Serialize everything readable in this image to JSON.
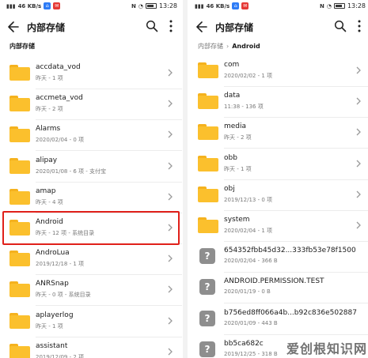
{
  "status": {
    "signal": "46 KB/s",
    "time": "13:28",
    "battery_icon": "battery-icon",
    "left_badge": "8",
    "right_badge": "N"
  },
  "left": {
    "title": "内部存储",
    "breadcrumb": [
      "内部存储"
    ],
    "items": [
      {
        "name": "accdata_vod",
        "meta": "昨天 - 1 项",
        "icon": "folder"
      },
      {
        "name": "accmeta_vod",
        "meta": "昨天 - 2 项",
        "icon": "folder"
      },
      {
        "name": "Alarms",
        "meta": "2020/02/04 - 0 项",
        "icon": "folder"
      },
      {
        "name": "alipay",
        "meta": "2020/01/08 - 6 项 - 支付宝",
        "icon": "folder"
      },
      {
        "name": "amap",
        "meta": "昨天 - 4 项",
        "icon": "folder"
      },
      {
        "name": "Android",
        "meta": "昨天 - 12 项 - 系统目录",
        "icon": "folder"
      },
      {
        "name": "AndroLua",
        "meta": "2019/12/18 - 1 项",
        "icon": "folder"
      },
      {
        "name": "ANRSnap",
        "meta": "昨天 - 0 项 - 系统目录",
        "icon": "folder"
      },
      {
        "name": "aplayerlog",
        "meta": "昨天 - 1 项",
        "icon": "folder"
      },
      {
        "name": "assistant",
        "meta": "2019/12/09 - 2 项",
        "icon": "folder"
      }
    ]
  },
  "right": {
    "title": "内部存储",
    "breadcrumb": [
      "内部存储",
      "Android"
    ],
    "items": [
      {
        "name": "com",
        "meta": "2020/02/02 - 1 项",
        "icon": "folder"
      },
      {
        "name": "data",
        "meta": "11:38 - 136 项",
        "icon": "folder"
      },
      {
        "name": "media",
        "meta": "昨天 - 2 项",
        "icon": "folder"
      },
      {
        "name": "obb",
        "meta": "昨天 - 1 项",
        "icon": "folder"
      },
      {
        "name": "obj",
        "meta": "2019/12/13 - 0 项",
        "icon": "folder"
      },
      {
        "name": "system",
        "meta": "2020/02/04 - 1 项",
        "icon": "folder"
      },
      {
        "name": "654352fbb45d32...333fb53e78f1500",
        "meta": "2020/02/04 - 366 B",
        "icon": "unknown"
      },
      {
        "name": "ANDROID.PERMISSION.TEST",
        "meta": "2020/01/19 - 0 B",
        "icon": "unknown"
      },
      {
        "name": "b756ed8ff066a4b...b92c836e502887",
        "meta": "2020/01/09 - 443 B",
        "icon": "unknown"
      },
      {
        "name": "bb5ca682c",
        "meta": "2019/12/25 - 318 B",
        "icon": "unknown"
      }
    ]
  },
  "watermark": "爱创根知识网"
}
